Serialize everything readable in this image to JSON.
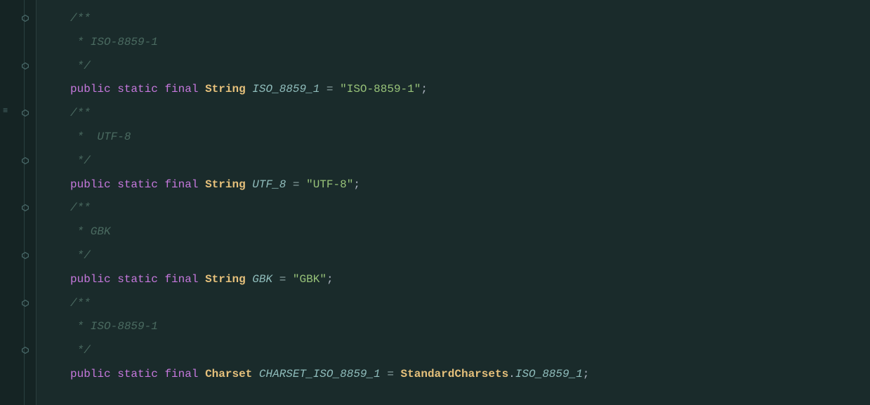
{
  "lines": [
    {
      "indent": "",
      "tokens": [
        {
          "cls": "tok-comment",
          "t": "/**"
        }
      ]
    },
    {
      "indent": "",
      "tokens": [
        {
          "cls": "tok-comment",
          "t": " * ISO-8859-1"
        }
      ]
    },
    {
      "indent": "",
      "tokens": [
        {
          "cls": "tok-comment",
          "t": " */"
        }
      ]
    },
    {
      "indent": "",
      "tokens": [
        {
          "cls": "tok-keyword",
          "t": "public"
        },
        {
          "cls": "",
          "t": " "
        },
        {
          "cls": "tok-keyword",
          "t": "static"
        },
        {
          "cls": "",
          "t": " "
        },
        {
          "cls": "tok-keyword",
          "t": "final"
        },
        {
          "cls": "",
          "t": " "
        },
        {
          "cls": "tok-type",
          "t": "String"
        },
        {
          "cls": "",
          "t": " "
        },
        {
          "cls": "tok-ident",
          "t": "ISO_8859_1"
        },
        {
          "cls": "",
          "t": " "
        },
        {
          "cls": "tok-op",
          "t": "="
        },
        {
          "cls": "",
          "t": " "
        },
        {
          "cls": "tok-string",
          "t": "\"ISO-8859-1\""
        },
        {
          "cls": "tok-punct",
          "t": ";"
        }
      ]
    },
    {
      "indent": "",
      "tokens": [
        {
          "cls": "tok-comment",
          "t": "/**"
        }
      ]
    },
    {
      "indent": "",
      "tokens": [
        {
          "cls": "tok-comment",
          "t": " *  UTF-8"
        }
      ]
    },
    {
      "indent": "",
      "tokens": [
        {
          "cls": "tok-comment",
          "t": " */"
        }
      ]
    },
    {
      "indent": "",
      "tokens": [
        {
          "cls": "tok-keyword",
          "t": "public"
        },
        {
          "cls": "",
          "t": " "
        },
        {
          "cls": "tok-keyword",
          "t": "static"
        },
        {
          "cls": "",
          "t": " "
        },
        {
          "cls": "tok-keyword",
          "t": "final"
        },
        {
          "cls": "",
          "t": " "
        },
        {
          "cls": "tok-type",
          "t": "String"
        },
        {
          "cls": "",
          "t": " "
        },
        {
          "cls": "tok-ident",
          "t": "UTF_8"
        },
        {
          "cls": "",
          "t": " "
        },
        {
          "cls": "tok-op",
          "t": "="
        },
        {
          "cls": "",
          "t": " "
        },
        {
          "cls": "tok-string",
          "t": "\"UTF-8\""
        },
        {
          "cls": "tok-punct",
          "t": ";"
        }
      ]
    },
    {
      "indent": "",
      "tokens": [
        {
          "cls": "tok-comment",
          "t": "/**"
        }
      ]
    },
    {
      "indent": "",
      "tokens": [
        {
          "cls": "tok-comment",
          "t": " * GBK"
        }
      ]
    },
    {
      "indent": "",
      "tokens": [
        {
          "cls": "tok-comment",
          "t": " */"
        }
      ]
    },
    {
      "indent": "",
      "tokens": [
        {
          "cls": "tok-keyword",
          "t": "public"
        },
        {
          "cls": "",
          "t": " "
        },
        {
          "cls": "tok-keyword",
          "t": "static"
        },
        {
          "cls": "",
          "t": " "
        },
        {
          "cls": "tok-keyword",
          "t": "final"
        },
        {
          "cls": "",
          "t": " "
        },
        {
          "cls": "tok-type",
          "t": "String"
        },
        {
          "cls": "",
          "t": " "
        },
        {
          "cls": "tok-ident",
          "t": "GBK"
        },
        {
          "cls": "",
          "t": " "
        },
        {
          "cls": "tok-op",
          "t": "="
        },
        {
          "cls": "",
          "t": " "
        },
        {
          "cls": "tok-string",
          "t": "\"GBK\""
        },
        {
          "cls": "tok-punct",
          "t": ";"
        }
      ]
    },
    {
      "indent": "",
      "tokens": [
        {
          "cls": "tok-comment",
          "t": "/**"
        }
      ]
    },
    {
      "indent": "",
      "tokens": [
        {
          "cls": "tok-comment",
          "t": " * ISO-8859-1"
        }
      ]
    },
    {
      "indent": "",
      "tokens": [
        {
          "cls": "tok-comment",
          "t": " */"
        }
      ]
    },
    {
      "indent": "",
      "tokens": [
        {
          "cls": "tok-keyword",
          "t": "public"
        },
        {
          "cls": "",
          "t": " "
        },
        {
          "cls": "tok-keyword",
          "t": "static"
        },
        {
          "cls": "",
          "t": " "
        },
        {
          "cls": "tok-keyword",
          "t": "final"
        },
        {
          "cls": "",
          "t": " "
        },
        {
          "cls": "tok-type",
          "t": "Charset"
        },
        {
          "cls": "",
          "t": " "
        },
        {
          "cls": "tok-ident",
          "t": "CHARSET_ISO_8859_1"
        },
        {
          "cls": "",
          "t": " "
        },
        {
          "cls": "tok-op",
          "t": "="
        },
        {
          "cls": "",
          "t": " "
        },
        {
          "cls": "tok-class",
          "t": "StandardCharsets"
        },
        {
          "cls": "tok-punct",
          "t": "."
        },
        {
          "cls": "tok-ident",
          "t": "ISO_8859_1"
        },
        {
          "cls": "tok-punct",
          "t": ";"
        }
      ]
    }
  ],
  "fold_rows": [
    0,
    2,
    4,
    6,
    8,
    10,
    12,
    14
  ],
  "minimap_icon_row": 4
}
